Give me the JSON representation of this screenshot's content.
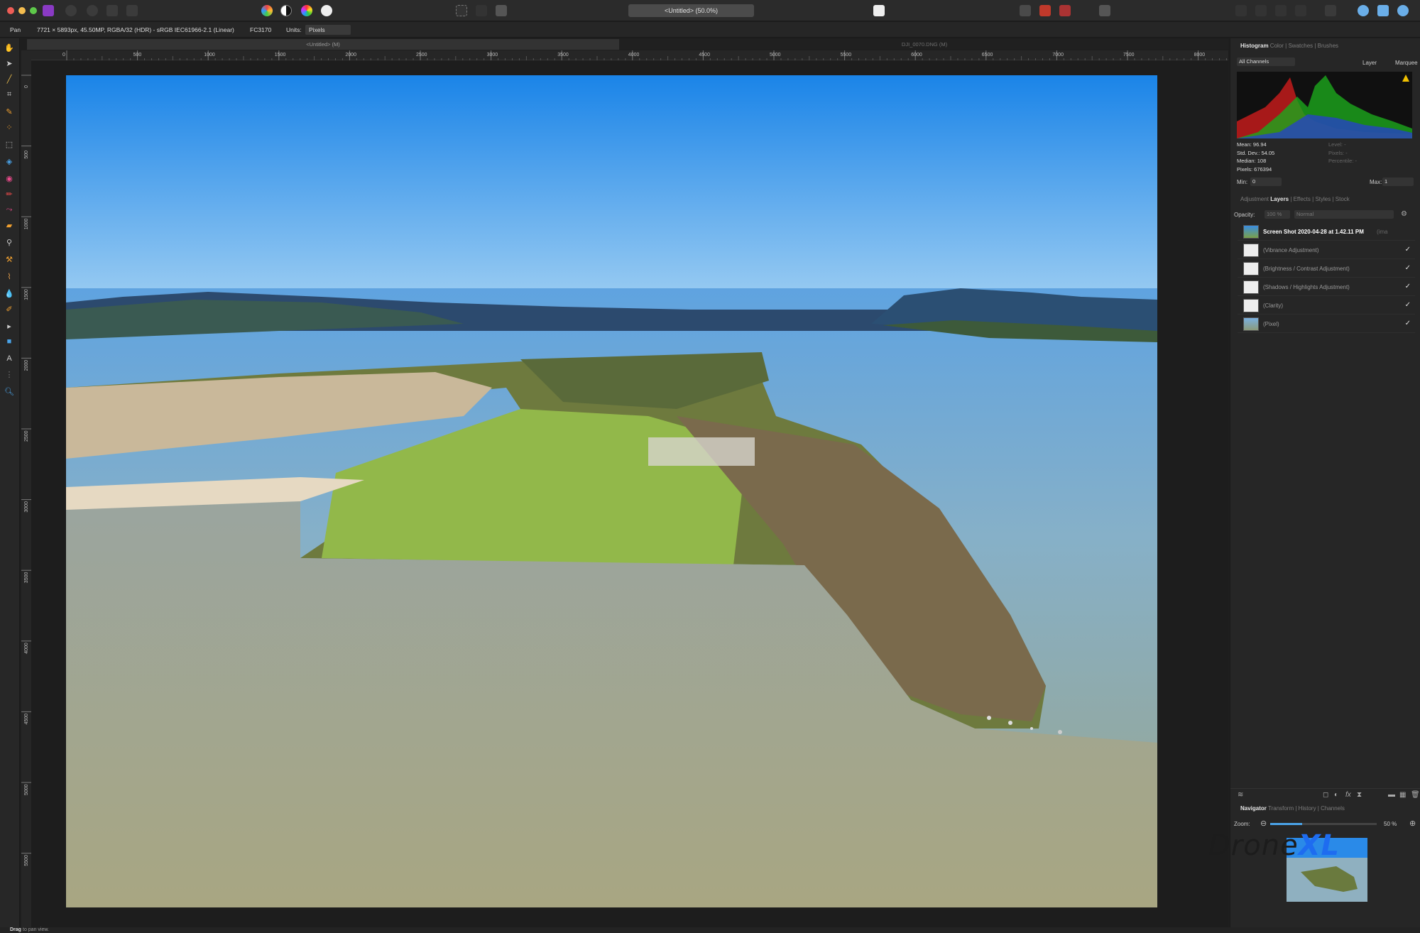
{
  "toolbar": {
    "document_title": "<Untitled> (50.0%)"
  },
  "context": {
    "tool": "Pan",
    "doc_info": "7721 × 5893px, 45.50MP, RGBA/32 (HDR) - sRGB IEC61966-2.1 (Linear)",
    "camera": "FC3170",
    "units_label": "Units:",
    "units_value": "Pixels"
  },
  "tabs": [
    {
      "label": "<Untitled> (M)"
    },
    {
      "label": "DJI_0070.DNG (M)"
    }
  ],
  "ruler": {
    "h_ticks": [
      "0",
      "500",
      "1000",
      "1500",
      "2000",
      "2500",
      "3000",
      "3500",
      "4000",
      "4500",
      "5000",
      "5500",
      "6000",
      "6500",
      "7000",
      "7500",
      "8000"
    ],
    "v_ticks": [
      "0",
      "500",
      "1000",
      "1500",
      "2000",
      "2500",
      "3000",
      "3500",
      "4000",
      "4500",
      "5000",
      "5500"
    ]
  },
  "histogram_panel": {
    "tabs": [
      "Histogram",
      "Color",
      "Swatches",
      "Brushes"
    ],
    "channel": "All Channels",
    "layer_opt": "Layer",
    "marquee_opt": "Marquee",
    "stats": [
      "Mean: 96.94",
      "Std. Dev.: 54.05",
      "Median: 108",
      "Pixels: 676394"
    ],
    "stats_right": [
      "Level: -",
      "Pixels: -",
      "Percentile: -"
    ],
    "min_label": "Min:",
    "min_value": "0",
    "max_label": "Max:",
    "max_value": "1"
  },
  "layers_panel": {
    "tabs": [
      "Adjustment",
      "Layers",
      "Effects",
      "Styles",
      "Stock"
    ],
    "opacity_label": "Opacity:",
    "opacity_value": "100 %",
    "blend_mode": "Normal",
    "layers": [
      {
        "name": "Screen Shot 2020-04-28 at 1.42.11 PM",
        "suffix": "(ima",
        "checked": false
      },
      {
        "name": "(Vibrance Adjustment)",
        "checked": true
      },
      {
        "name": "(Brightness / Contrast Adjustment)",
        "checked": true
      },
      {
        "name": "(Shadows / Highlights Adjustment)",
        "checked": true
      },
      {
        "name": "(Clarity)",
        "checked": true
      },
      {
        "name": "(Pixel)",
        "checked": true
      }
    ],
    "check_glyph": "✓"
  },
  "navigator_panel": {
    "tabs": [
      "Navigator",
      "Transform",
      "History",
      "Channels"
    ],
    "zoom_label": "Zoom:",
    "zoom_value": "50 %",
    "zoom_fraction": 0.3
  },
  "status": {
    "bold": "Drag",
    "text": " to pan view."
  },
  "watermark": {
    "part1": "Drone",
    "part2": "XL"
  }
}
